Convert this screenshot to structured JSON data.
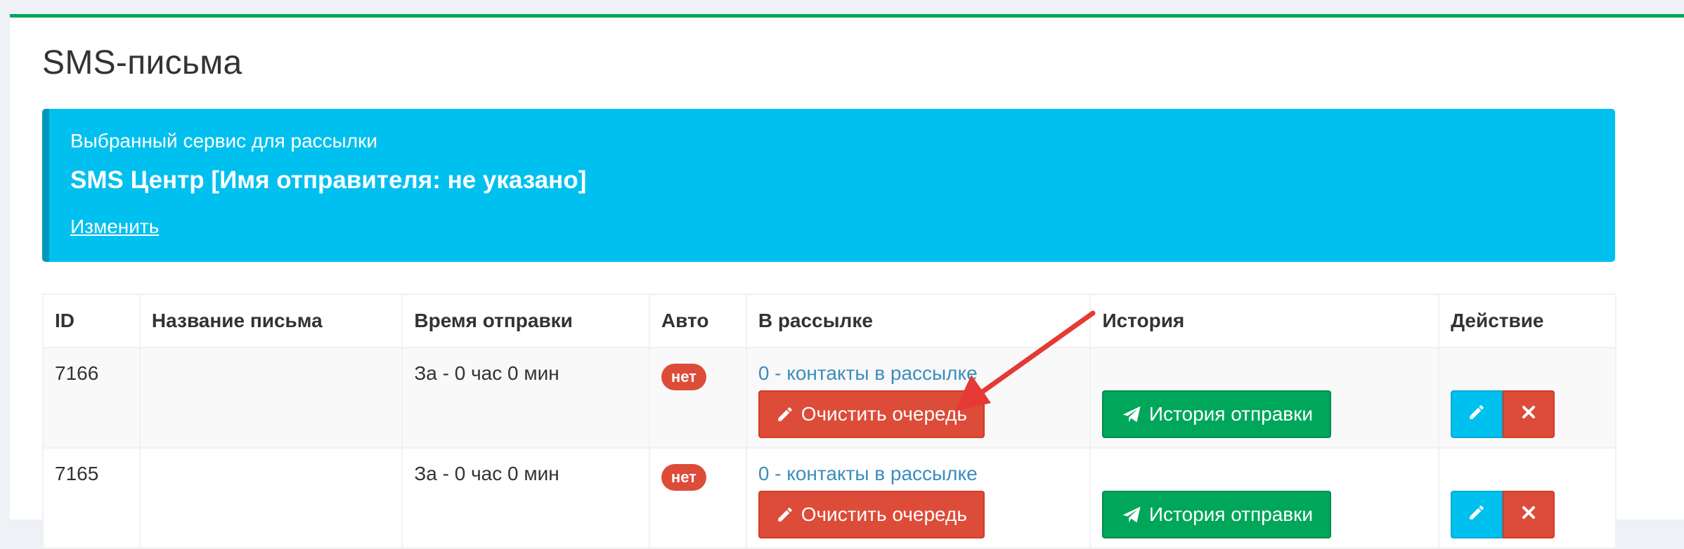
{
  "page": {
    "title": "SMS-письма"
  },
  "service": {
    "caption": "Выбранный сервис для рассылки",
    "name": "SMS Центр [Имя отправителя: не указано]",
    "change_link": "Изменить"
  },
  "table": {
    "headers": [
      "ID",
      "Название письма",
      "Время отправки",
      "Авто",
      "В рассылке",
      "История",
      "Действие"
    ],
    "rows": [
      {
        "id": "7166",
        "name": "",
        "send_time": "За - 0 час 0 мин",
        "auto": "нет",
        "contacts": "0 - контакты в рассылке",
        "clear_label": "Очистить очередь",
        "history_label": "История отправки"
      },
      {
        "id": "7165",
        "name": "",
        "send_time": "За - 0 час 0 мин",
        "auto": "нет",
        "contacts": "0 - контакты в рассылке",
        "clear_label": "Очистить очередь",
        "history_label": "История отправки"
      }
    ]
  },
  "colors": {
    "accent_green": "#00a65a",
    "info_blue": "#00c0ef",
    "danger_red": "#dd4b39",
    "link_blue": "#3c8dbc",
    "annotation_arrow": "#e53935"
  },
  "icons": {
    "clear": "pencil-icon",
    "history": "paper-plane-icon",
    "edit": "pencil-icon",
    "delete": "close-icon"
  }
}
